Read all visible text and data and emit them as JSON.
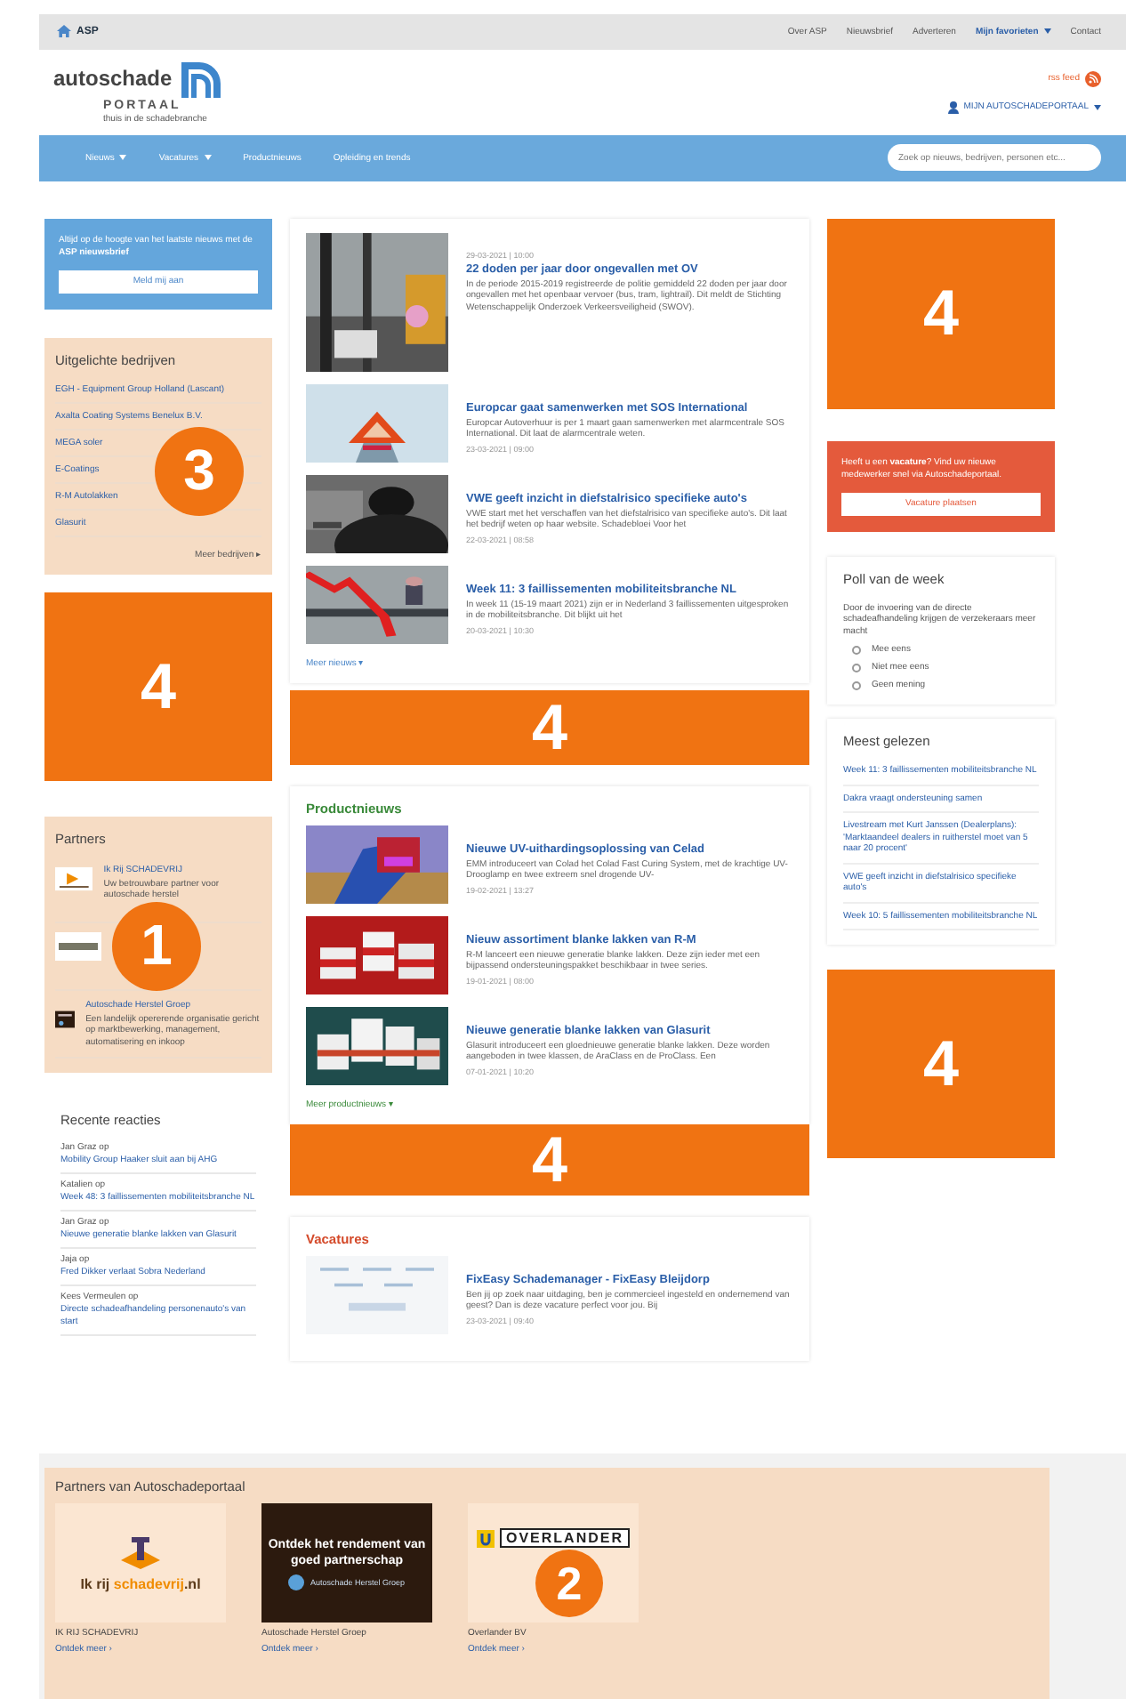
{
  "top_bar": {
    "home": "ASP",
    "links": [
      {
        "label": "Over ASP",
        "selected": false,
        "dropdown": false
      },
      {
        "label": "Nieuwsbrief",
        "selected": false,
        "dropdown": false
      },
      {
        "label": "Adverteren",
        "selected": false,
        "dropdown": false
      },
      {
        "label": "Mijn favorieten",
        "selected": true,
        "dropdown": true
      },
      {
        "label": "Contact",
        "selected": false,
        "dropdown": false
      }
    ]
  },
  "header": {
    "logo_word": "autoschade",
    "logo_sub": "PORTAAL",
    "tagline": "thuis in de schadebranche",
    "rss": "rss feed",
    "account": "MIJN AUTOSCHADEPORTAAL"
  },
  "nav": {
    "items": [
      {
        "label": "Nieuws",
        "dropdown": true
      },
      {
        "label": "Vacatures",
        "dropdown": true
      },
      {
        "label": "Productnieuws",
        "dropdown": false
      },
      {
        "label": "Opleiding en trends",
        "dropdown": false
      }
    ],
    "search": {
      "placeholder": "Zoek op nieuws, bedrijven, personen etc..."
    }
  },
  "left": {
    "newsletter": {
      "text": "Altijd op de hoogte van het laatste nieuws met de **ASP nieuwsbrief**",
      "button": "Meld mij aan"
    },
    "featured": {
      "title": "Uitgelichte bedrijven",
      "items": [
        "EGH - Equipment Group Holland (Lascant)",
        "Axalta Coating Systems Benelux B.V.",
        "MEGA soler",
        "E-Coatings",
        "R-M Autolakken",
        "Glasurit"
      ],
      "more": "Meer bedrijven ▸",
      "marker": "3"
    },
    "ad": "4",
    "partners": {
      "title": "Partners",
      "items": [
        {
          "kind": "ribbon",
          "name": "Ik Rij SCHADEVRIJ",
          "text": "Uw betrouwbare partner voor autoschade herstel"
        },
        {
          "kind": "stripes"
        },
        {
          "kind": "dark",
          "name": "Autoschade Herstel Groep",
          "text": "Een landelijk opererende organisatie gericht op marktbewerking, management, automatisering en inkoop"
        }
      ],
      "marker": "1"
    },
    "recent": {
      "title": "Recente reacties",
      "items": [
        {
          "text": "Jan Graz op",
          "link": "Mobility Group Haaker sluit aan bij AHG"
        },
        {
          "text": "Katalien op",
          "link": "Week 48: 3 faillissementen mobiliteitsbranche NL"
        },
        {
          "text": "Jan Graz op",
          "link": "Nieuwe generatie blanke lakken van Glasurit"
        },
        {
          "text": "Jaja op",
          "link": "Fred Dikker verlaat Sobra Nederland"
        },
        {
          "text": "Kees Vermeulen op",
          "link": "Directe schadeafhandeling personenauto's van start"
        }
      ]
    }
  },
  "center": {
    "news": [
      {
        "kind": "street",
        "date": "29-03-2021 | 10:00",
        "title": "22 doden per jaar door ongevallen met OV",
        "excerpt": "In de periode 2015-2019 registreerde de politie gemiddeld 22 doden per jaar door ongevallen met het openbaar vervoer (bus, tram, lightrail). Dit meldt de Stichting Wetenschappelijk Onderzoek Verkeersveiligheid (SWOV)."
      },
      {
        "kind": "triangle",
        "title": "Europcar gaat samenwerken met SOS International",
        "excerpt": "Europcar Autoverhuur is per 1 maart gaan samenwerken met alarmcentrale SOS International. Dit laat de alarmcentrale weten.",
        "date": "23-03-2021 | 09:00"
      },
      {
        "kind": "thief",
        "title": "VWE geeft inzicht in diefstalrisico specifieke auto's",
        "excerpt": "VWE start met het verschaffen van het diefstalrisico van specifieke auto's. Dit laat het bedrijf weten op haar website. Schadebloei Voor het",
        "date": "22-03-2021 | 08:58"
      },
      {
        "kind": "arrow",
        "title": "Week 11: 3 faillissementen mobiliteitsbranche NL",
        "excerpt": "In week 11 (15-19 maart 2021) zijn er in Nederland 3 faillissementen uitgesproken in de mobiliteitsbranche. Dit blijkt uit het",
        "date": "20-03-2021 | 10:30"
      }
    ],
    "more_news": "Meer nieuws ▾",
    "ad1": "4",
    "product_title": "Productnieuws",
    "products": [
      {
        "kind": "uv",
        "title": "Nieuwe UV-uithardingsoplossing van Celad",
        "excerpt": "EMM introduceert van Colad het Colad Fast Curing System, met de krachtige UV-Drooglamp en twee extreem snel drogende UV-",
        "date": "19-02-2021 | 13:27"
      },
      {
        "kind": "cans",
        "title": "Nieuw assortiment blanke lakken van R-M",
        "excerpt": "R-M lanceert een nieuwe generatie blanke lakken. Deze zijn ieder met een bijpassend ondersteuningspakket beschikbaar in twee series.",
        "date": "19-01-2021 | 08:00"
      },
      {
        "kind": "cans2",
        "title": "Nieuwe generatie blanke lakken van Glasurit",
        "excerpt": "Glasurit introduceert een gloednieuwe generatie blanke lakken. Deze worden aangeboden in twee klassen, de AraClass en de ProClass. Een",
        "date": "07-01-2021 | 10:20"
      }
    ],
    "more_products": "Meer productnieuws ▾",
    "ad2": "4",
    "vacancy_title": "Vacatures",
    "vacancies": [
      {
        "kind": "logo",
        "title": "FixEasy Schademanager - FixEasy Bleijdorp",
        "excerpt": "Ben jij op zoek naar uitdaging, ben je commercieel ingesteld en ondernemend van geest? Dan is deze vacature perfect voor jou. Bij",
        "date": "23-03-2021 | 09:40"
      }
    ]
  },
  "right": {
    "ad1": "4",
    "vacancy_box": {
      "text": "Heeft u een **vacature**? Vind uw nieuwe medewerker snel via Autoschadeportaal.",
      "button": "Vacature plaatsen"
    },
    "poll": {
      "title": "Poll van de week",
      "question": "Door de invoering van de directe schadeafhandeling krijgen de verzekeraars meer macht",
      "options": [
        {
          "label": "Mee eens",
          "selected": false
        },
        {
          "label": "Niet mee eens",
          "selected": false
        },
        {
          "label": "Geen mening",
          "selected": false
        }
      ]
    },
    "most_read": {
      "title": "Meest gelezen",
      "items": [
        "Week 11: 3 faillissementen mobiliteitsbranche NL",
        "Dakra vraagt ondersteuning samen",
        "Livestream met Kurt Janssen (Dealerplans): 'Marktaandeel dealers in ruitherstel moet van 5 naar 20 procent'",
        "VWE geeft inzicht in diefstalrisico specifieke auto's",
        "Week 10: 5 faillissementen mobiliteitsbranche NL"
      ]
    },
    "ad2": "4"
  },
  "footer": {
    "title": "Partners van Autoschadeportaal",
    "marker": "2",
    "partners": [
      {
        "kind": "schadevrij",
        "logo_text": "Ik rij **schadevrij**.nl",
        "name": "IK RIJ SCHADEVRIJ",
        "more": "Ontdek meer ›"
      },
      {
        "kind": "banner",
        "logo_text": "Ontdek het rendement van goed partnerschap",
        "logo_sub": "Autoschade Herstel Groep",
        "name": "Autoschade Herstel Groep",
        "more": "Ontdek meer ›"
      },
      {
        "kind": "overlander",
        "logo_text": "OVERLANDER",
        "name": "Overlander BV",
        "more": "Ontdek meer ›"
      }
    ]
  }
}
